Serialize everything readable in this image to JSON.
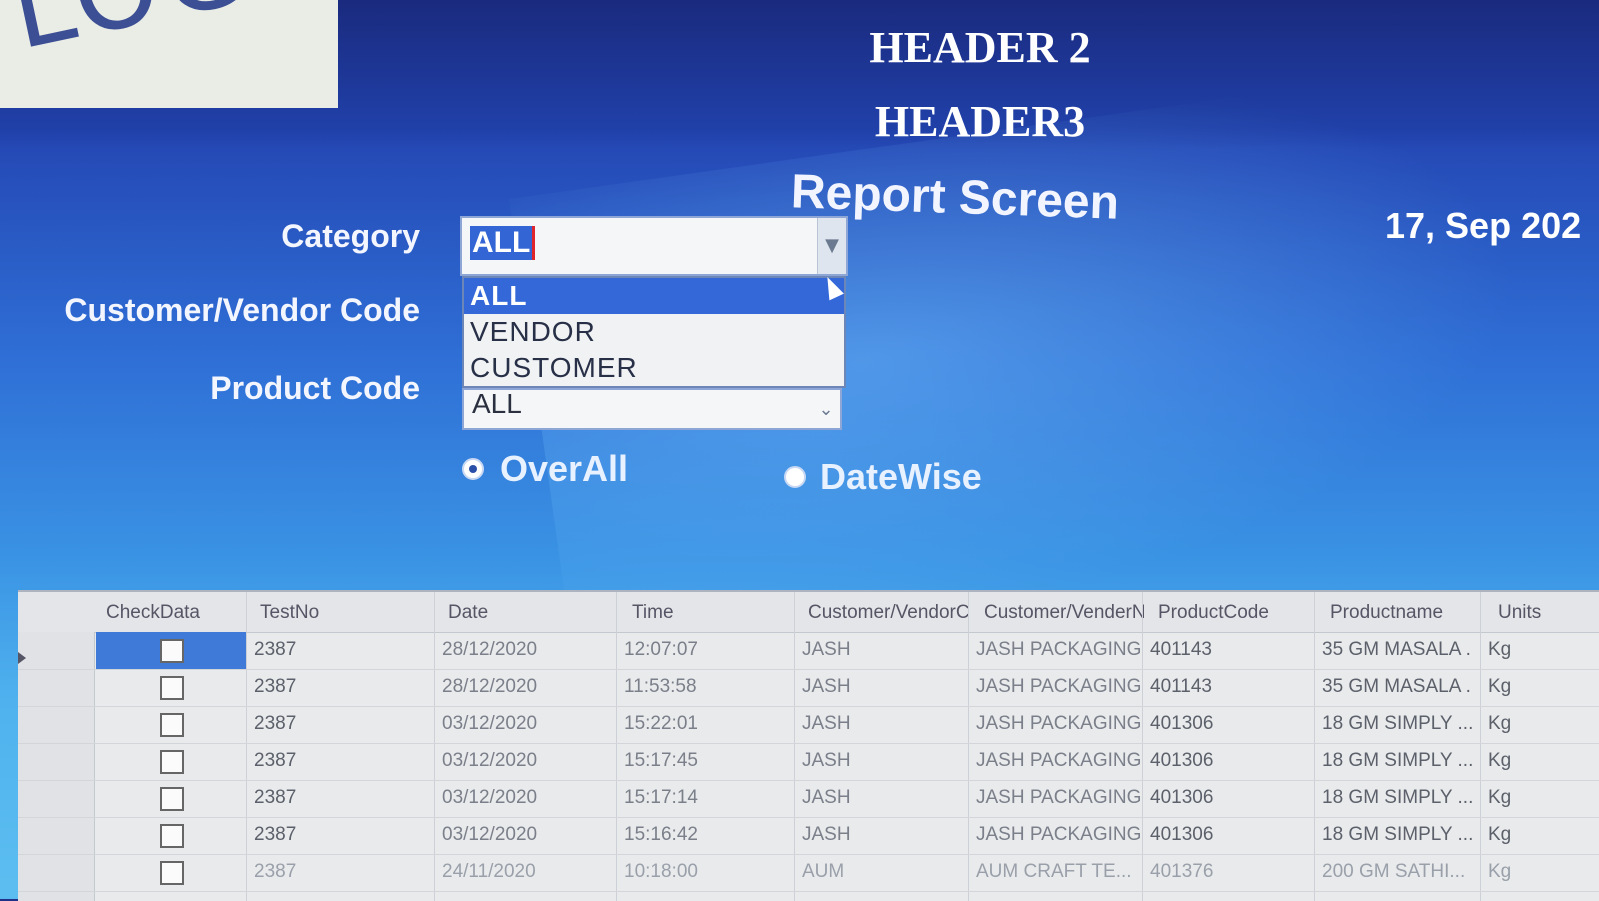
{
  "logo": {
    "text": "LOGO"
  },
  "headers": {
    "header2": "HEADER 2",
    "header3": "HEADER3",
    "screen_title": "Report Screen"
  },
  "date_text": "17, Sep 202",
  "filters": {
    "category": {
      "label": "Category",
      "value": "ALL",
      "options": [
        "ALL",
        "VENDOR",
        "CUSTOMER"
      ],
      "highlighted_option": "ALL"
    },
    "customer_vendor_code": {
      "label": "Customer/Vendor Code"
    },
    "product_code": {
      "label": "Product Code",
      "value": "ALL"
    }
  },
  "view_mode": {
    "options": [
      {
        "label": "OverAll",
        "checked": true
      },
      {
        "label": "DateWise",
        "checked": false
      }
    ]
  },
  "grid": {
    "columns": [
      "CheckData",
      "TestNo",
      "Date",
      "Time",
      "Customer/VendorC",
      "Customer/VenderN",
      "ProductCode",
      "Productname",
      "Units"
    ],
    "rows": [
      {
        "checked": false,
        "selected": true,
        "test_no": "2387",
        "date": "28/12/2020",
        "time": "12:07:07",
        "cv_code": "JASH",
        "cv_name": "JASH PACKAGING",
        "product_code": "401143",
        "product_name": "35 GM MASALA ...",
        "units": "Kg"
      },
      {
        "checked": false,
        "selected": false,
        "test_no": "2387",
        "date": "28/12/2020",
        "time": "11:53:58",
        "cv_code": "JASH",
        "cv_name": "JASH PACKAGING",
        "product_code": "401143",
        "product_name": "35 GM MASALA ...",
        "units": "Kg"
      },
      {
        "checked": false,
        "selected": false,
        "test_no": "2387",
        "date": "03/12/2020",
        "time": "15:22:01",
        "cv_code": "JASH",
        "cv_name": "JASH PACKAGING",
        "product_code": "401306",
        "product_name": "18 GM SIMPLY ...",
        "units": "Kg"
      },
      {
        "checked": false,
        "selected": false,
        "test_no": "2387",
        "date": "03/12/2020",
        "time": "15:17:45",
        "cv_code": "JASH",
        "cv_name": "JASH PACKAGING",
        "product_code": "401306",
        "product_name": "18 GM SIMPLY ...",
        "units": "Kg"
      },
      {
        "checked": false,
        "selected": false,
        "test_no": "2387",
        "date": "03/12/2020",
        "time": "15:17:14",
        "cv_code": "JASH",
        "cv_name": "JASH PACKAGING",
        "product_code": "401306",
        "product_name": "18 GM SIMPLY ...",
        "units": "Kg"
      },
      {
        "checked": false,
        "selected": false,
        "test_no": "2387",
        "date": "03/12/2020",
        "time": "15:16:42",
        "cv_code": "JASH",
        "cv_name": "JASH PACKAGING",
        "product_code": "401306",
        "product_name": "18 GM SIMPLY ...",
        "units": "Kg"
      },
      {
        "checked": false,
        "selected": false,
        "test_no": "2387",
        "date": "24/11/2020",
        "time": "10:18:00",
        "cv_code": "AUM",
        "cv_name": "AUM CRAFT TE...",
        "product_code": "401376",
        "product_name": "200 GM SATHI...",
        "units": "Kg"
      }
    ]
  },
  "colors": {
    "accent": "#3465d4",
    "header_band": "#1a2a7e",
    "selection": "#3f7ad8"
  }
}
